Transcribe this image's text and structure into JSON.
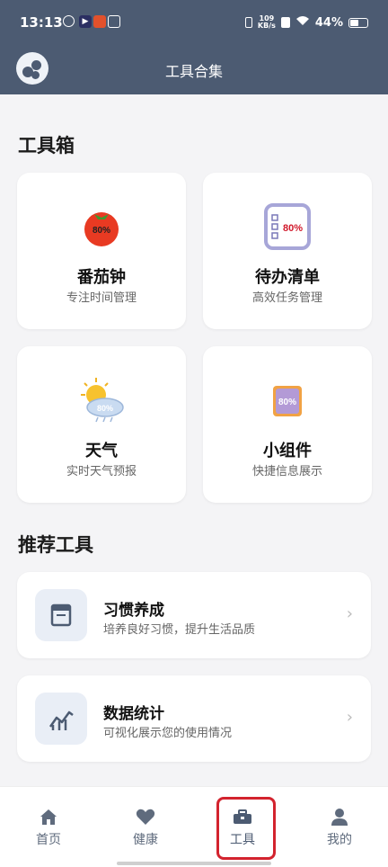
{
  "status_bar": {
    "time": "13:13",
    "speed_value": "109",
    "speed_unit": "KB/s",
    "battery": "44%"
  },
  "header": {
    "title": "工具合集"
  },
  "toolbox": {
    "title": "工具箱",
    "items": [
      {
        "name": "番茄钟",
        "desc": "专注时间管理",
        "icon": "tomato-icon",
        "badge": "80%"
      },
      {
        "name": "待办清单",
        "desc": "高效任务管理",
        "icon": "checklist-icon",
        "badge": "80%"
      },
      {
        "name": "天气",
        "desc": "实时天气预报",
        "icon": "weather-icon",
        "badge": "80%"
      },
      {
        "name": "小组件",
        "desc": "快捷信息展示",
        "icon": "widget-icon",
        "badge": "80%"
      }
    ]
  },
  "recommended": {
    "title": "推荐工具",
    "items": [
      {
        "name": "习惯养成",
        "desc": "培养良好习惯，提升生活品质",
        "icon": "calendar-icon",
        "chevron": "›"
      },
      {
        "name": "数据统计",
        "desc": "可视化展示您的使用情况",
        "icon": "chart-icon",
        "chevron": "›"
      }
    ]
  },
  "bottom_nav": {
    "items": [
      {
        "label": "首页",
        "icon": "home-icon"
      },
      {
        "label": "健康",
        "icon": "heart-icon"
      },
      {
        "label": "工具",
        "icon": "toolbox-icon",
        "active": true
      },
      {
        "label": "我的",
        "icon": "person-icon"
      }
    ]
  },
  "colors": {
    "header": "#4c5b72",
    "highlight": "#d3232e",
    "background": "#f4f4f6"
  }
}
